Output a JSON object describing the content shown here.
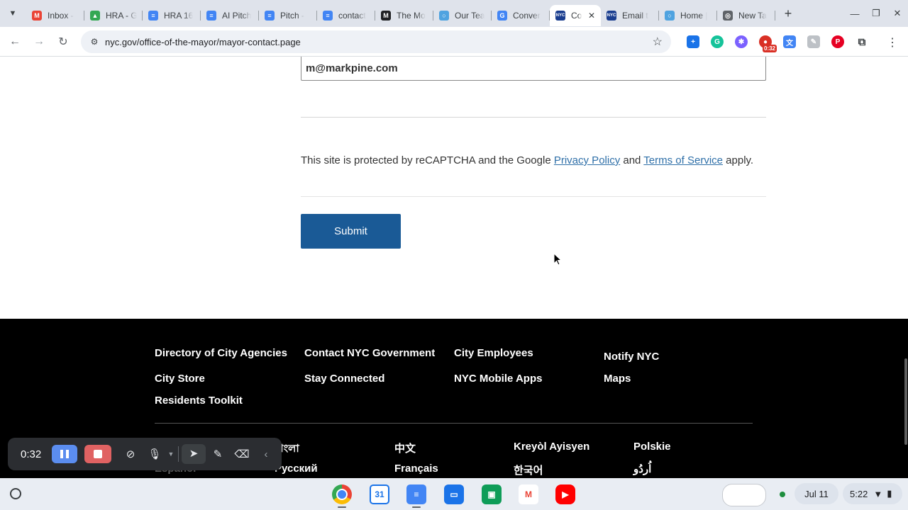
{
  "browser": {
    "tabs": [
      {
        "title": "Inbox - ",
        "color": "#ea4335",
        "glyph": "M"
      },
      {
        "title": "HRA - G",
        "color": "#34a853",
        "glyph": "▲"
      },
      {
        "title": "HRA 16",
        "color": "#4285f4",
        "glyph": "≡"
      },
      {
        "title": "AI Pitch",
        "color": "#4285f4",
        "glyph": "≡"
      },
      {
        "title": "Pitch - ",
        "color": "#4285f4",
        "glyph": "≡"
      },
      {
        "title": "contact",
        "color": "#4285f4",
        "glyph": "≡"
      },
      {
        "title": "The Mo",
        "color": "#202124",
        "glyph": "M"
      },
      {
        "title": "Our Tea",
        "color": "#4fa3e0",
        "glyph": "○"
      },
      {
        "title": "Conver",
        "color": "#4285f4",
        "glyph": "G"
      },
      {
        "title": "Co",
        "color": "#1a3d8f",
        "glyph": "NYC",
        "active": true
      },
      {
        "title": "Email t",
        "color": "#1a3d8f",
        "glyph": "NYC"
      },
      {
        "title": "Home |",
        "color": "#4fa3e0",
        "glyph": "○"
      },
      {
        "title": "New Ta",
        "color": "#5f6368",
        "glyph": "◎"
      }
    ],
    "url": "nyc.gov/office-of-the-mayor/mayor-contact.page",
    "recording_badge": "0:32"
  },
  "form": {
    "email_value": "m@markpine.com",
    "recaptcha_prefix": "This site is protected by reCAPTCHA and the Google ",
    "privacy_link": "Privacy Policy",
    "recaptcha_and": " and ",
    "terms_link": "Terms of Service",
    "recaptcha_suffix": " apply.",
    "submit_label": "Submit"
  },
  "footer": {
    "links": {
      "directory": "Directory of City Agencies",
      "contact": "Contact NYC Government",
      "employees": "City Employees",
      "notify": "Notify NYC",
      "store": "City Store",
      "connected": "Stay Connected",
      "apps": "NYC Mobile Apps",
      "maps": "Maps",
      "toolkit": "Residents Toolkit"
    },
    "languages": {
      "bengali": "বাংলা",
      "chinese": "中文",
      "kreyol": "Kreyòl Ayisyen",
      "polish": "Polskie",
      "spanish": "Español",
      "russian": "Русский",
      "french": "Français",
      "korean": "한국어",
      "urdu": "اُردُو"
    }
  },
  "recorder": {
    "elapsed": "0:32"
  },
  "shelf": {
    "calendar_day": "31",
    "date": "Jul 11",
    "time": "5:22"
  }
}
